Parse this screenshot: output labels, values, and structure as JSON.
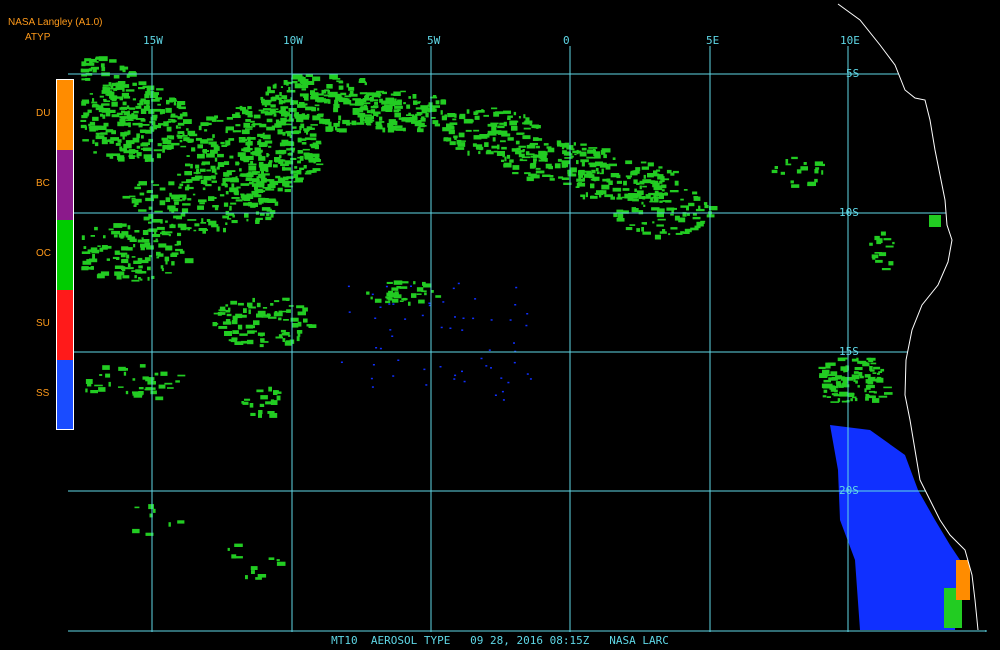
{
  "header": {
    "source": "NASA Langley (A1.0)",
    "param": "ATYP"
  },
  "legend": [
    {
      "code": "DU",
      "color": "#ff8c00"
    },
    {
      "code": "BC",
      "color": "#8b1a8b"
    },
    {
      "code": "OC",
      "color": "#00cc00"
    },
    {
      "code": "SU",
      "color": "#ff1a1a"
    },
    {
      "code": "SS",
      "color": "#1a4cff"
    }
  ],
  "grid": {
    "lon_labels": [
      "15W",
      "10W",
      "5W",
      "0",
      "5E",
      "10E"
    ],
    "lat_labels": [
      "5S",
      "10S",
      "15S",
      "20S"
    ]
  },
  "footer": "MT10  AEROSOL TYPE   09 28, 2016 08:15Z   NASA LARC",
  "colors": {
    "grid": "#5fd7e6",
    "coast": "#ffffff",
    "oc": "#22cc22",
    "ss": "#1030ff",
    "du": "#ff8c00"
  }
}
